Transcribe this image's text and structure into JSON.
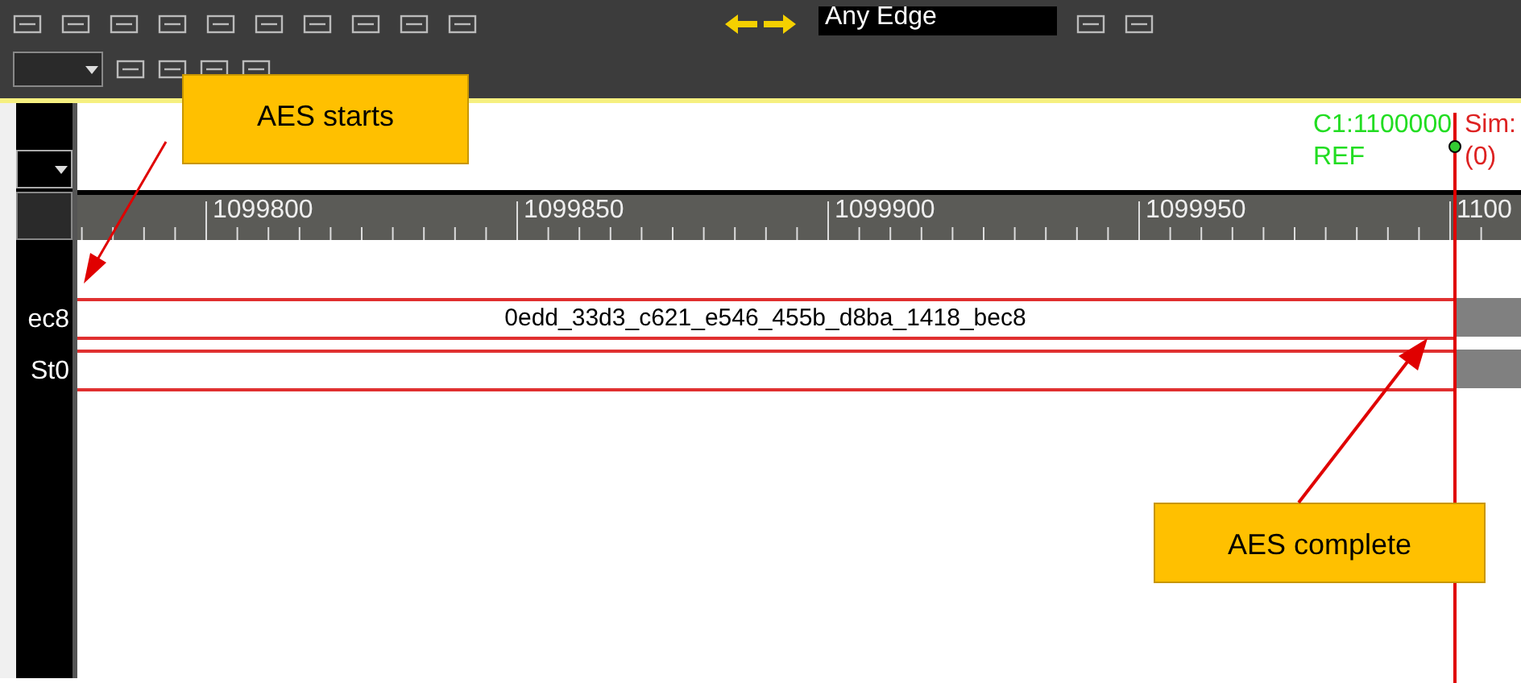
{
  "toolbar": {
    "edge_field": "Any Edge"
  },
  "cursor": {
    "label": "C1:1100000",
    "ref": "REF",
    "sim": "Sim:",
    "sim_value": "(0)"
  },
  "ruler": {
    "ticks": [
      "1099800",
      "1099850",
      "1099900",
      "1099950",
      "1100"
    ]
  },
  "signals": [
    {
      "name": "ec8",
      "value": "0edd_33d3_c621_e546_455b_d8ba_1418_bec8"
    },
    {
      "name": "St0"
    }
  ],
  "annotations": [
    {
      "kind": "start",
      "text": "AES starts"
    },
    {
      "kind": "end",
      "text": "AES complete"
    }
  ]
}
